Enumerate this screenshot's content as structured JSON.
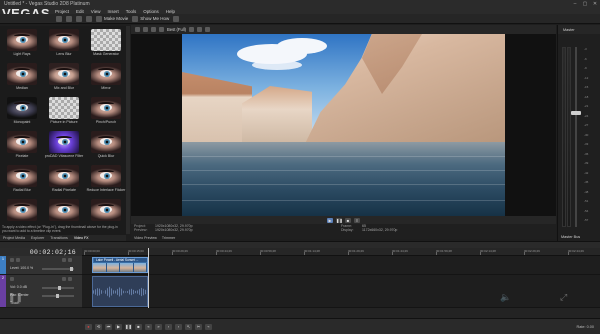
{
  "window": {
    "title": "Untitled * - Vegas Studio 2D8 Platinum",
    "controls": [
      "–",
      "▢",
      "✕"
    ]
  },
  "logo": "VEGAS",
  "menu": [
    "Project",
    "Edit",
    "View",
    "Insert",
    "Tools",
    "Options",
    "Help"
  ],
  "toolbar": {
    "make_movie": "Make Movie",
    "show_me_how": "Show Me How"
  },
  "effects": {
    "items": [
      {
        "label": "Light Rays",
        "style": "eye"
      },
      {
        "label": "Lens Blur",
        "style": "eye"
      },
      {
        "label": "Mask Generator",
        "style": "checker"
      },
      {
        "label": "Median",
        "style": "eye"
      },
      {
        "label": "Mix and Blur",
        "style": "alt2"
      },
      {
        "label": "Mirror",
        "style": "eye"
      },
      {
        "label": "Monopaint",
        "style": "alt1"
      },
      {
        "label": "Picture in Picture",
        "style": "checker"
      },
      {
        "label": "Pinch/Punch",
        "style": "eye"
      },
      {
        "label": "Pixelate",
        "style": "eye"
      },
      {
        "label": "proDAD Vitascene Filter",
        "style": "purple"
      },
      {
        "label": "Quick Blur",
        "style": "eye"
      },
      {
        "label": "Radial Blur",
        "style": "eye"
      },
      {
        "label": "Radial Pixelate",
        "style": "eye"
      },
      {
        "label": "Reduce Interlace Flicker",
        "style": "eye"
      },
      {
        "label": "",
        "style": "eye"
      },
      {
        "label": "",
        "style": "eye"
      },
      {
        "label": "",
        "style": "eye"
      }
    ],
    "description": "To apply a video effect (or \"Plug-In\"), drag the thumbnail above for the plug-in you want to add to a timeline clip event.",
    "tabs": [
      "Project Media",
      "Explorer",
      "Transitions",
      "Video FX"
    ]
  },
  "preview": {
    "quality": "Best (Full)",
    "info": {
      "project": "1920x1080x32, 29.970p",
      "preview": "1920x1080x32, 29.970p",
      "frame": "65",
      "display": "1172x660x32, 29.970p"
    },
    "tabs": [
      "Video Preview",
      "Trimmer"
    ]
  },
  "master": {
    "title": "Master",
    "label": "Master Bus",
    "ticks": [
      "-3",
      "-6",
      "-9",
      "-12",
      "-15",
      "-18",
      "-21",
      "-24",
      "-27",
      "-30",
      "-33",
      "-36",
      "-39",
      "-42",
      "-45",
      "-48",
      "-51",
      "-54",
      "-57"
    ]
  },
  "timeline": {
    "timecode": "00:02:02;16",
    "ruler": [
      "00:00:00;00",
      "00:00:15;00",
      "00:00:29;29",
      "00:00:44;29",
      "00:00:59;28",
      "00:01:14;28",
      "00:01:29;29",
      "00:01:44;29",
      "00:01:59;28",
      "00:02:14;28",
      "00:02:29;29",
      "00:02:44;29"
    ],
    "video_track": {
      "num": "1",
      "level": "Level: 100.0 %",
      "color": "#3d7fc4"
    },
    "audio_track": {
      "num": "2",
      "vol": "Vol: 0.0 dB",
      "pan": "Pan: Center",
      "touch": "Touch",
      "color": "#6a3fa3"
    },
    "clip_title": "Lake Powell - Aerial Sunset ..."
  },
  "status": {
    "rate": "Rate: 0.00"
  }
}
